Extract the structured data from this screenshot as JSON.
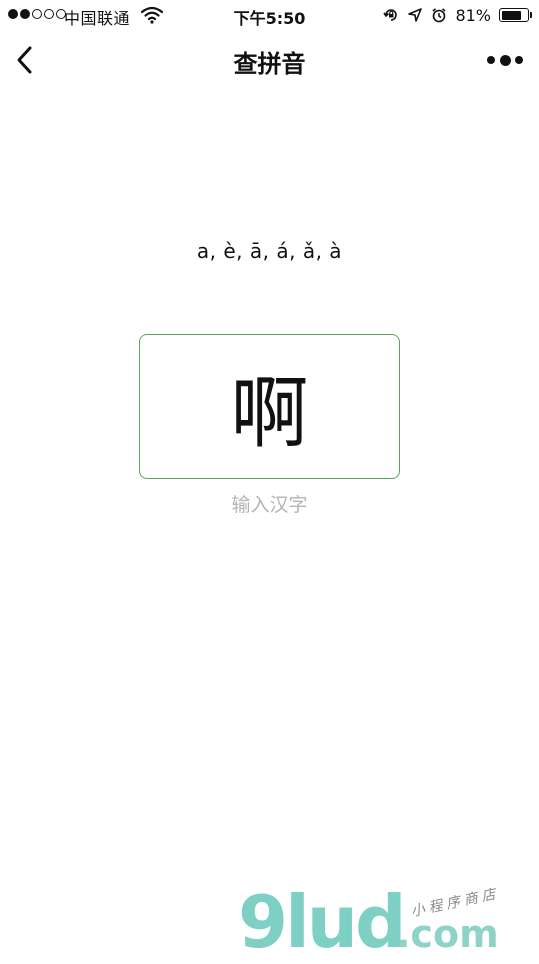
{
  "status_bar": {
    "carrier": "中国联通",
    "time": "下午5:50",
    "battery_percent": "81%",
    "battery_level": 0.81,
    "signal_strength": 2,
    "signal_total": 5,
    "icons": [
      "signal-dots-icon",
      "wifi-icon",
      "orientation-lock-icon",
      "location-icon",
      "alarm-icon",
      "battery-icon"
    ]
  },
  "nav": {
    "title": "查拼音",
    "back_icon": "chevron-left-icon",
    "more_icon": "more-dots-icon"
  },
  "main": {
    "pinyin_result": "a, è, ā, á, ǎ, à",
    "input_value": "啊",
    "input_hint": "输入汉字",
    "accent_color": "#5aa35a"
  },
  "watermark": {
    "logo": "9lud",
    "domain": ".com",
    "tagline": "小程序商店"
  }
}
